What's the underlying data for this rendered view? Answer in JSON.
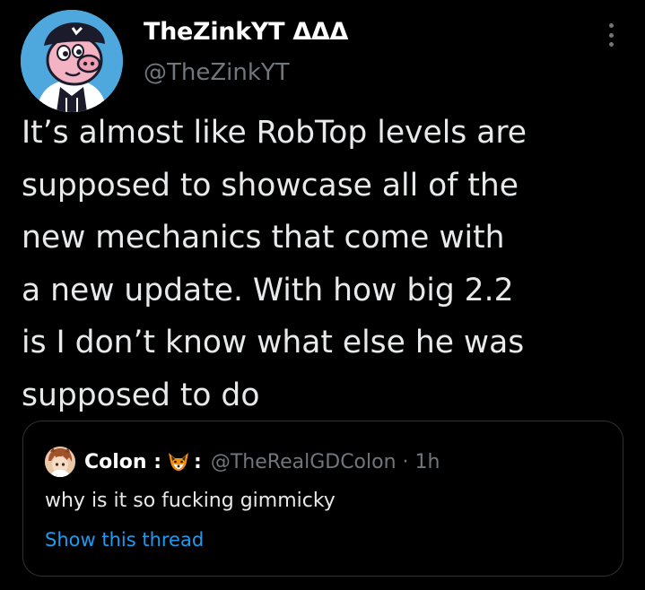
{
  "tweet": {
    "author_name": "TheZinkYT ΔΔΔ",
    "author_handle": "@TheZinkYT",
    "text_lines": [
      "It’s almost like RobTop levels are",
      "supposed to showcase all of the",
      "new mechanics that come with",
      "a new update. With how big 2.2",
      "is I don’t know what else he was",
      "supposed to do"
    ],
    "icons": {
      "avatar": "cartoon-pig-avatar",
      "more": "more-options-icon"
    }
  },
  "quoted_tweet": {
    "author_name": "Colon :",
    "name_suffix": ":",
    "author_handle": "@TheRealGDColon",
    "separator": "·",
    "time": "1h",
    "text": "why is it so fucking gimmicky",
    "show_thread": "Show this thread",
    "icons": {
      "avatar": "anime-character-avatar",
      "emoji": "fox-face-icon"
    }
  },
  "colors": {
    "background": "#000000",
    "primary_text": "#e7e9ea",
    "secondary_text": "#71767b",
    "link": "#1d9bf0",
    "border": "#2f3336"
  }
}
